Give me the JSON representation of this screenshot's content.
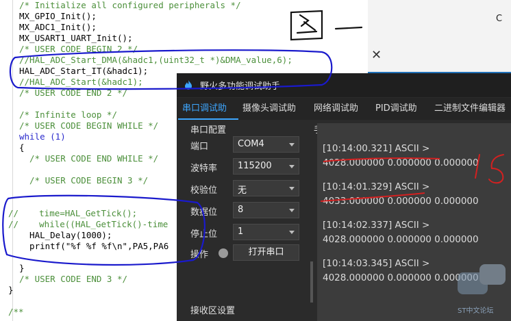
{
  "editor": {
    "lines": [
      {
        "text": "/* Initialize all configured peripherals */",
        "kind": "comment",
        "indent": 0
      },
      {
        "text": "MX_GPIO_Init();",
        "kind": "code",
        "indent": 0
      },
      {
        "text": "MX_ADC1_Init();",
        "kind": "code",
        "indent": 0
      },
      {
        "text": "MX_USART1_UART_Init();",
        "kind": "code",
        "indent": 0
      },
      {
        "text": "/* USER CODE BEGIN 2 */",
        "kind": "comment",
        "indent": 0
      },
      {
        "text": "//HAL_ADC_Start_DMA(&hadc1,(uint32_t *)&DMA_value,6);",
        "kind": "comment",
        "indent": 0
      },
      {
        "text": "HAL_ADC_Start_IT(&hadc1);",
        "kind": "code",
        "indent": 0
      },
      {
        "text": "//HAL_ADC_Start(&hadc1);",
        "kind": "comment",
        "indent": 0
      },
      {
        "text": "/* USER CODE END 2 */",
        "kind": "comment",
        "indent": 0
      },
      {
        "text": "",
        "kind": "code",
        "indent": 0
      },
      {
        "text": "/* Infinite loop */",
        "kind": "comment",
        "indent": 0
      },
      {
        "text": "/* USER CODE BEGIN WHILE */",
        "kind": "comment",
        "indent": 0
      },
      {
        "text": "while (1)",
        "kind": "kw",
        "indent": 0
      },
      {
        "text": "{",
        "kind": "code",
        "indent": 0
      },
      {
        "text": "  /* USER CODE END WHILE */",
        "kind": "comment",
        "indent": 0
      },
      {
        "text": "",
        "kind": "code",
        "indent": 0
      },
      {
        "text": "  /* USER CODE BEGIN 3 */",
        "kind": "comment",
        "indent": 0
      },
      {
        "text": "",
        "kind": "code",
        "indent": 0
      },
      {
        "text": "",
        "kind": "code",
        "indent": 0
      },
      {
        "text": "//    time=HAL_GetTick();",
        "kind": "comment",
        "indent": -1
      },
      {
        "text": "//    while((HAL_GetTick()-time",
        "kind": "comment",
        "indent": -1
      },
      {
        "text": "  HAL_Delay(1000);",
        "kind": "code",
        "indent": 0
      },
      {
        "text": "  printf(\"%f %f %f\\n\",PA5,PA6",
        "kind": "code",
        "indent": 0
      },
      {
        "text": "",
        "kind": "code",
        "indent": 0
      },
      {
        "text": "}",
        "kind": "code",
        "indent": 0
      },
      {
        "text": "/* USER CODE END 3 */",
        "kind": "comment",
        "indent": 0
      },
      {
        "text": "}",
        "kind": "code",
        "indent": -1
      },
      {
        "text": "",
        "kind": "code",
        "indent": 0
      },
      {
        "text": "/**",
        "kind": "comment",
        "indent": -1
      }
    ]
  },
  "handwriting": {
    "figure_label": "图一",
    "side_mark": "1.5"
  },
  "app": {
    "title": "野火多功能调试助手",
    "tabs": [
      "串口调试助手",
      "摄像头调试助手",
      "网络调试助手",
      "PID调试助手",
      "二进制文件编辑器"
    ],
    "active_tab": 0,
    "serial_config": {
      "title": "串口配置",
      "fields": [
        {
          "label": "端口",
          "value": "COM4"
        },
        {
          "label": "波特率",
          "value": "115200"
        },
        {
          "label": "校验位",
          "value": "无"
        },
        {
          "label": "数据位",
          "value": "8"
        },
        {
          "label": "停止位",
          "value": "1"
        }
      ],
      "operation_label": "操作",
      "open_button": "打开串口"
    },
    "receive_settings_title": "接收区设置",
    "receive": [
      {
        "header": "[10:14:00.321] ASCII >",
        "data": "4028.000000 0.000000 0.000000"
      },
      {
        "header": "[10:14:01.329] ASCII >",
        "data": "4033.000000 0.000000 0.000000"
      },
      {
        "header": "[10:14:02.337] ASCII >",
        "data": "4028.000000 0.000000 0.000000"
      },
      {
        "header": "[10:14:03.345] ASCII >",
        "data": "4028.000000 0.000000 0.000000"
      }
    ]
  },
  "desktop": {
    "close_glyph": "✕",
    "edge_letter": "C"
  },
  "watermark": "ST中文论坛",
  "colors": {
    "accent": "#3da6ff",
    "annotation_blue": "#1a1acc",
    "annotation_red": "#d42020"
  }
}
